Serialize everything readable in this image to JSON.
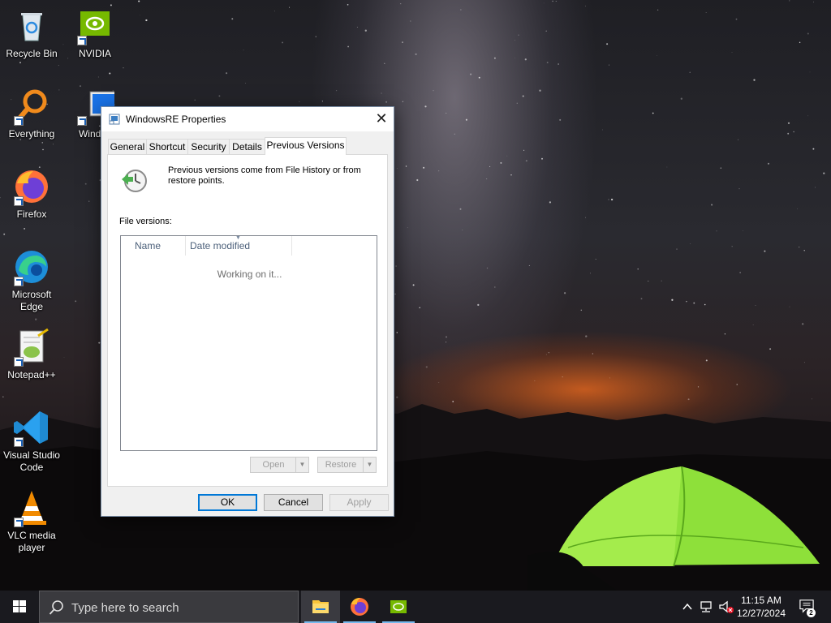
{
  "desktop": {
    "icons": [
      {
        "label": "Recycle Bin",
        "icon": "recycle-bin-icon"
      },
      {
        "label": "NVIDIA",
        "icon": "nvidia-icon"
      },
      {
        "label": "Everything",
        "icon": "everything-search-icon"
      },
      {
        "label": "Windov",
        "icon": "windows-installer-icon"
      },
      {
        "label": "Firefox",
        "icon": "firefox-icon"
      },
      {
        "label": "Microsoft Edge",
        "icon": "edge-icon"
      },
      {
        "label": "Notepad++",
        "icon": "notepad-plus-plus-icon"
      },
      {
        "label": "Visual Studio Code",
        "icon": "vscode-icon"
      },
      {
        "label": "VLC media player",
        "icon": "vlc-icon"
      }
    ]
  },
  "dialog": {
    "title": "WindowsRE Properties",
    "close_symbol": "✕",
    "tabs": [
      {
        "label": "General"
      },
      {
        "label": "Shortcut"
      },
      {
        "label": "Security"
      },
      {
        "label": "Details"
      },
      {
        "label": "Previous Versions",
        "active": true
      }
    ],
    "intro_text": "Previous versions come from File History or from restore points.",
    "versions_label": "File versions:",
    "columns": [
      "Name",
      "Date modified"
    ],
    "status_text": "Working on it...",
    "open_label": "Open",
    "restore_label": "Restore",
    "ok_label": "OK",
    "cancel_label": "Cancel",
    "apply_label": "Apply"
  },
  "taskbar": {
    "search_placeholder": "Type here to search",
    "apps": [
      {
        "name": "File Explorer",
        "icon": "file-explorer-icon",
        "state": "active"
      },
      {
        "name": "Firefox",
        "icon": "firefox-icon",
        "state": "running"
      },
      {
        "name": "NVIDIA",
        "icon": "nvidia-icon",
        "state": "running"
      }
    ],
    "time": "11:15 AM",
    "date": "12/27/2024",
    "notification_count": "2"
  },
  "colors": {
    "accent": "#0078d7",
    "taskbar": "#1a1a1f",
    "tent_green": "#7ed321"
  }
}
